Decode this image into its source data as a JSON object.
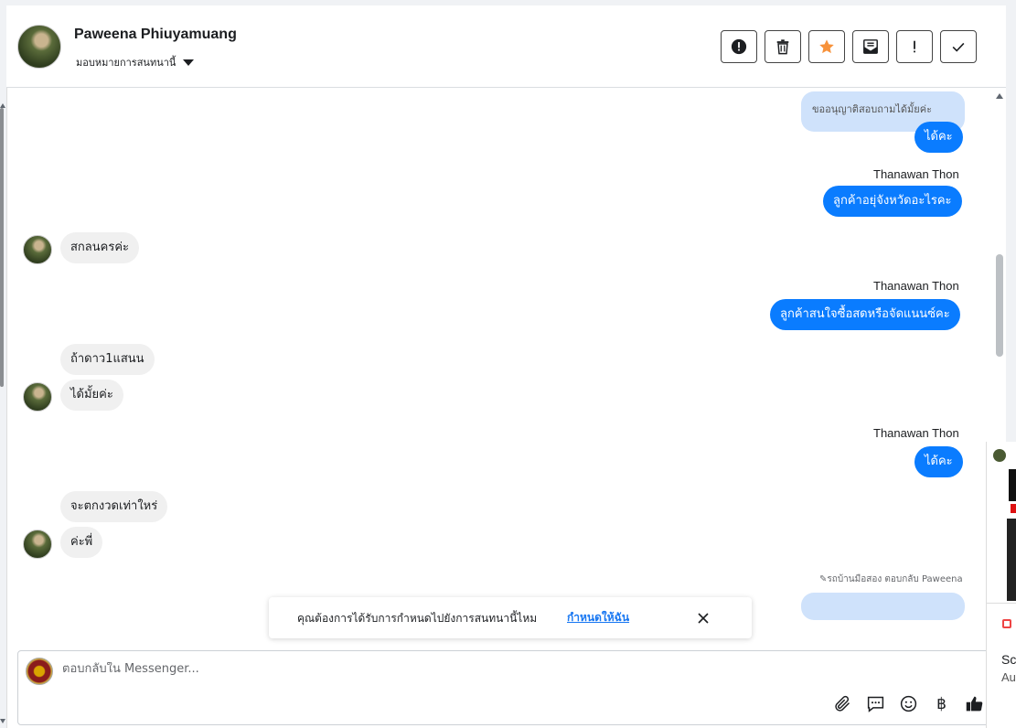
{
  "header": {
    "contact_name": "Paweena Phiuyamuang",
    "assign_label": "มอบหมายการสนทนานี้",
    "actions": [
      {
        "name": "report-button",
        "icon": "alert-circle-icon"
      },
      {
        "name": "delete-button",
        "icon": "trash-icon"
      },
      {
        "name": "star-button",
        "icon": "star-icon"
      },
      {
        "name": "mark-unread-button",
        "icon": "envelope-icon"
      },
      {
        "name": "spam-button",
        "icon": "exclamation-icon"
      },
      {
        "name": "done-button",
        "icon": "check-icon"
      }
    ]
  },
  "messages": {
    "quote_text": "ขออนุญาติสอบถามได้มั้ยค่ะ",
    "m1": "ได้คะ",
    "sender1": "Thanawan Thon",
    "m2": "ลูกค้าอยุ่จังหวัดอะไรคะ",
    "m3": "สกลนครค่ะ",
    "sender2": "Thanawan Thon",
    "m4": "ลูกค้าสนใจซื้อสดหรือจัดแนนซ์คะ",
    "m5": "ถ้าดาว1แสนน",
    "m6": "ได้มั้ยค่ะ",
    "sender3": "Thanawan Thon",
    "m7": "ได้คะ",
    "m8": "จะตกงวดเท่าใหร่",
    "m9": "ค่ะพี่",
    "reply_note": "รถบ้านมือสอง ตอบกลับ Paweena"
  },
  "assign_prompt": {
    "text": "คุณต้องการได้รับการกำหนดไปยังการสนทนานี้ไหม",
    "link": "กำหนดให้ฉัน"
  },
  "composer": {
    "placeholder": "ตอบกลับใน Messenger...",
    "tools": [
      "paperclip-icon",
      "saved-reply-icon",
      "emoji-icon",
      "baht-icon",
      "like-icon"
    ]
  },
  "right_panel": {
    "text1": "Scr",
    "text2": "Au"
  },
  "colors": {
    "outgoing": "#0a7cff",
    "incoming": "#f0f0f0",
    "star": "#f7923b",
    "link": "#1877f2"
  }
}
